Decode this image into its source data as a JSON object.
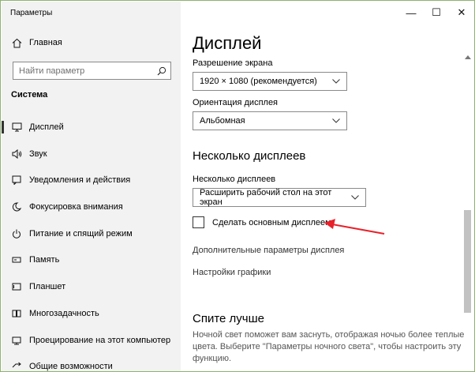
{
  "window": {
    "title": "Параметры"
  },
  "controls": {
    "minimize": "—",
    "maximize": "☐",
    "close": "✕"
  },
  "sidebar": {
    "home": {
      "label": "Главная",
      "icon": "home-icon"
    },
    "search": {
      "placeholder": "Найти параметр"
    },
    "section": "Система",
    "items": [
      {
        "label": "Дисплей",
        "icon": "monitor-icon",
        "active": true
      },
      {
        "label": "Звук",
        "icon": "speaker-icon"
      },
      {
        "label": "Уведомления и действия",
        "icon": "notification-icon"
      },
      {
        "label": "Фокусировка внимания",
        "icon": "moon-icon"
      },
      {
        "label": "Питание и спящий режим",
        "icon": "power-icon"
      },
      {
        "label": "Память",
        "icon": "storage-icon"
      },
      {
        "label": "Планшет",
        "icon": "tablet-icon"
      },
      {
        "label": "Многозадачность",
        "icon": "multitasking-icon"
      },
      {
        "label": "Проецирование на этот компьютер",
        "icon": "projection-icon"
      },
      {
        "label": "Общие возможности",
        "icon": "shared-icon"
      }
    ]
  },
  "main": {
    "title": "Дисплей",
    "resolution": {
      "label": "Разрешение экрана",
      "value": "1920 × 1080 (рекомендуется)"
    },
    "orientation": {
      "label": "Ориентация дисплея",
      "value": "Альбомная"
    },
    "multi": {
      "heading": "Несколько дисплеев",
      "label": "Несколько дисплеев",
      "value": "Расширить рабочий стол на этот экран"
    },
    "checkbox": {
      "label": "Сделать основным дисплеем",
      "checked": false
    },
    "links": [
      "Дополнительные параметры дисплея",
      "Настройки графики"
    ],
    "night": {
      "heading": "Спите лучше",
      "text": "Ночной свет поможет вам заснуть, отображая ночью более теплые цвета. Выберите \"Параметры ночного света\", чтобы настроить эту функцию."
    }
  },
  "colors": {
    "sidebar_bg": "#f2f2f2",
    "arrow": "#e8212b",
    "border": "#8fb36f"
  }
}
